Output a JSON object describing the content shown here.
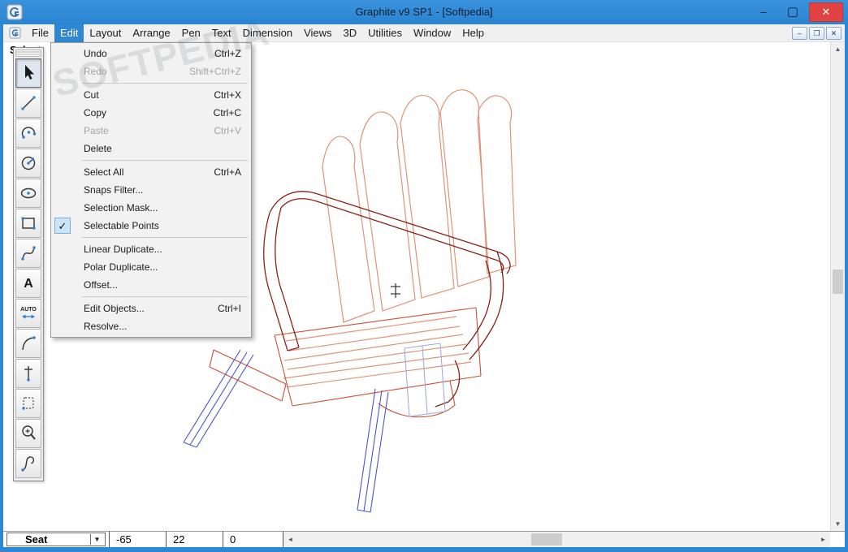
{
  "window": {
    "title": "Graphite v9 SP1 - [Softpedia]",
    "controls": {
      "minimize": "–",
      "maximize": "▢",
      "close": "✕"
    }
  },
  "menubar": {
    "items": [
      {
        "label": "File"
      },
      {
        "label": "Edit",
        "active": true
      },
      {
        "label": "Layout"
      },
      {
        "label": "Arrange"
      },
      {
        "label": "Pen"
      },
      {
        "label": "Text"
      },
      {
        "label": "Dimension"
      },
      {
        "label": "Views"
      },
      {
        "label": "3D"
      },
      {
        "label": "Utilities"
      },
      {
        "label": "Window"
      },
      {
        "label": "Help"
      }
    ],
    "mdi_controls": {
      "minimize": "–",
      "restore": "❐",
      "close": "✕"
    }
  },
  "prompt": {
    "label": "Select:"
  },
  "edit_menu": {
    "checkmark": "✓",
    "items": [
      {
        "label": "Undo",
        "shortcut": "Ctrl+Z"
      },
      {
        "label": "Redo",
        "shortcut": "Shift+Ctrl+Z",
        "disabled": true
      },
      {
        "label": "Cut",
        "shortcut": "Ctrl+X"
      },
      {
        "label": "Copy",
        "shortcut": "Ctrl+C"
      },
      {
        "label": "Paste",
        "shortcut": "Ctrl+V",
        "disabled": true
      },
      {
        "label": "Delete"
      },
      {
        "label": "Select All",
        "shortcut": "Ctrl+A"
      },
      {
        "label": "Snaps Filter..."
      },
      {
        "label": "Selection Mask..."
      },
      {
        "label": "Selectable Points",
        "checked": true
      },
      {
        "label": "Linear Duplicate..."
      },
      {
        "label": "Polar Duplicate..."
      },
      {
        "label": "Offset..."
      },
      {
        "label": "Edit Objects...",
        "shortcut": "Ctrl+I"
      },
      {
        "label": "Resolve..."
      }
    ]
  },
  "toolbar": {
    "tools": [
      "select-arrow",
      "line",
      "arc",
      "circle",
      "ellipse",
      "rectangle",
      "spline",
      "text",
      "auto-dimension",
      "fillet",
      "perpendicular",
      "chamfer",
      "zoom",
      "curve"
    ],
    "auto_label": "AUTO",
    "text_tool_glyph": "A"
  },
  "canvas": {
    "watermark": "SOFTPEDIA",
    "colors": {
      "back_slats": "#dd9478",
      "seat_frame": "#c94f35",
      "arms": "#8b2015",
      "front_legs": "#4a56c8",
      "hidden_lines": "#9aa6e0",
      "titlebar": "#2e87d4"
    }
  },
  "scroll_icons": {
    "up": "▲",
    "down": "▼",
    "left": "◄",
    "right": "►",
    "combo": "▼"
  },
  "statusbar": {
    "layer_selector": "Seat",
    "x": "-65",
    "y": "22",
    "z": "0"
  }
}
